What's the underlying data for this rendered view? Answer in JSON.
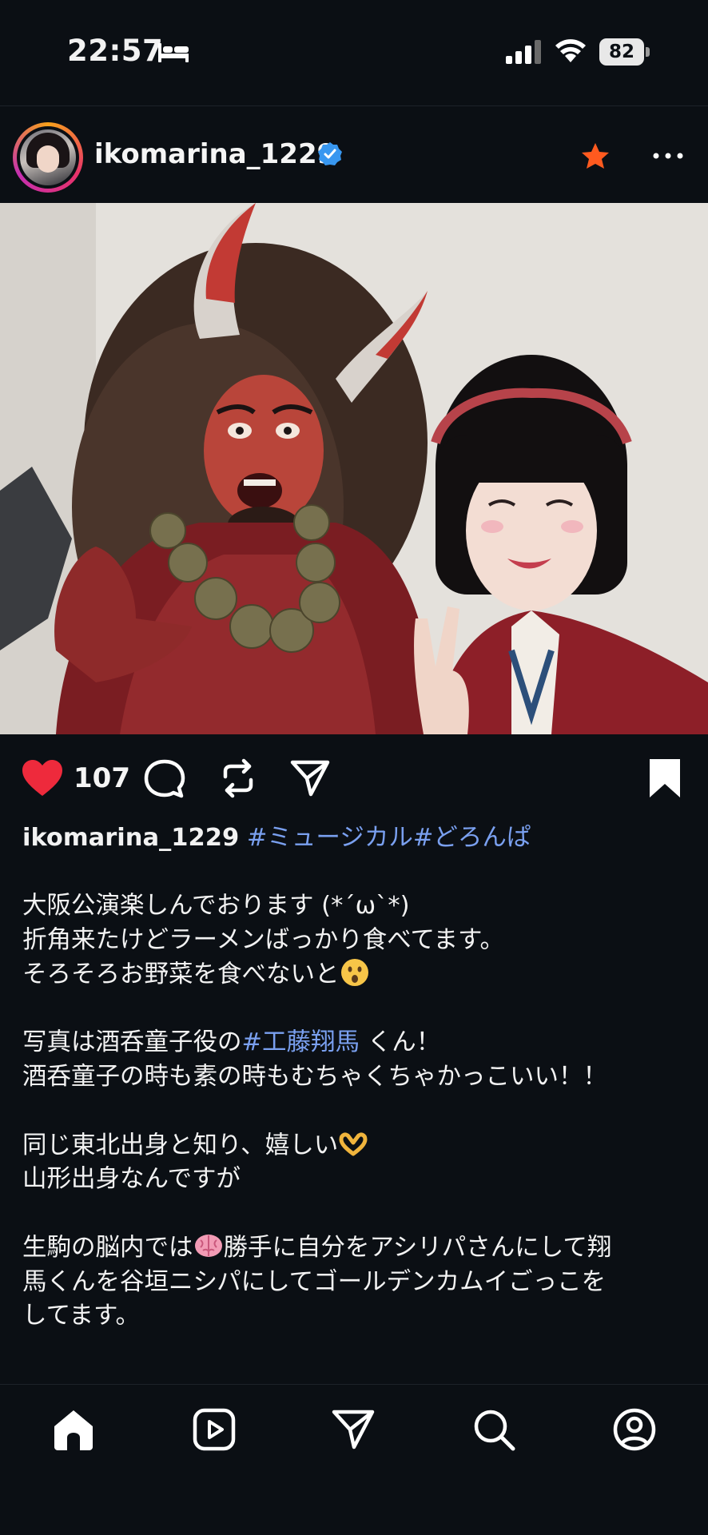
{
  "status_bar": {
    "time": "22:57",
    "battery": "82",
    "icons": [
      "bed-icon",
      "signal-icon",
      "wifi-icon",
      "battery-icon"
    ]
  },
  "post": {
    "username": "ikomarina_1229",
    "verified": true,
    "favorited": true,
    "like_count": "107",
    "liked": true,
    "saved": true,
    "colors": {
      "like": "#ee2a3c",
      "tag": "#7aa0f0",
      "star": "#ff5a1f",
      "verified": "#3897f0"
    },
    "caption": {
      "user": "ikomarina_1229",
      "tags_line": "#ミュージカル#どろんぱ",
      "line1": "大阪公演楽しんでおります (*´ω`*)",
      "line2": "折角来たけどラーメンばっかり食べてます。",
      "line3": "そろそろお野菜を食べないと",
      "line4_prefix": "写真は酒呑童子役の",
      "line4_tag": "#工藤翔馬",
      "line4_suffix": " くん！",
      "line5": "酒呑童子の時も素の時もむちゃくちゃかっこいい！！",
      "line6": "同じ東北出身と知り、嬉しい",
      "line7": "山形出身なんですが",
      "line8_prefix": "生駒の脳内では",
      "line8_suffix": "勝手に自分をアシリパさんにして翔",
      "line9": "馬くんを谷垣ニシパにしてゴールデンカムイごっこを",
      "line10": "してます。",
      "emoji_icons": [
        "hushed-face-emoji",
        "heart-hands-emoji",
        "brain-emoji"
      ]
    }
  },
  "bottom_nav": [
    "home-icon",
    "reels-icon",
    "messages-icon",
    "search-icon",
    "profile-icon"
  ]
}
